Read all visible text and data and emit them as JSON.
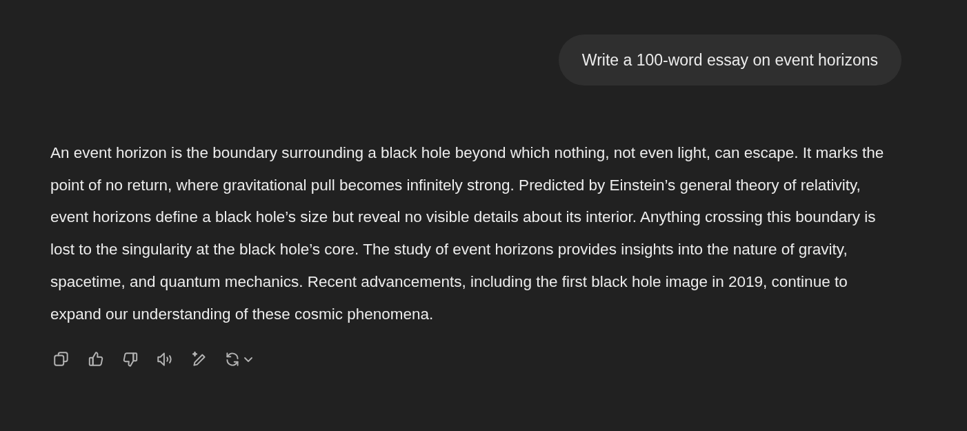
{
  "user_message": "Write a 100-word essay on event horizons",
  "response": "An event horizon is the boundary surrounding a black hole beyond which nothing, not even light, can escape. It marks the point of no return, where gravitational pull becomes infinitely strong. Predicted by Einstein’s general theory of relativity, event horizons define a black hole’s size but reveal no visible details about its interior. Anything crossing this boundary is lost to the singularity at the black hole’s core. The study of event horizons provides insights into the nature of gravity, spacetime, and quantum mechanics. Recent advancements, including the first black hole image in 2019, continue to expand our understanding of these cosmic phenomena.",
  "actions": [
    {
      "kind": "copy"
    },
    {
      "kind": "like"
    },
    {
      "kind": "dislike"
    },
    {
      "kind": "speak"
    },
    {
      "kind": "edit"
    },
    {
      "kind": "regenerate"
    }
  ]
}
